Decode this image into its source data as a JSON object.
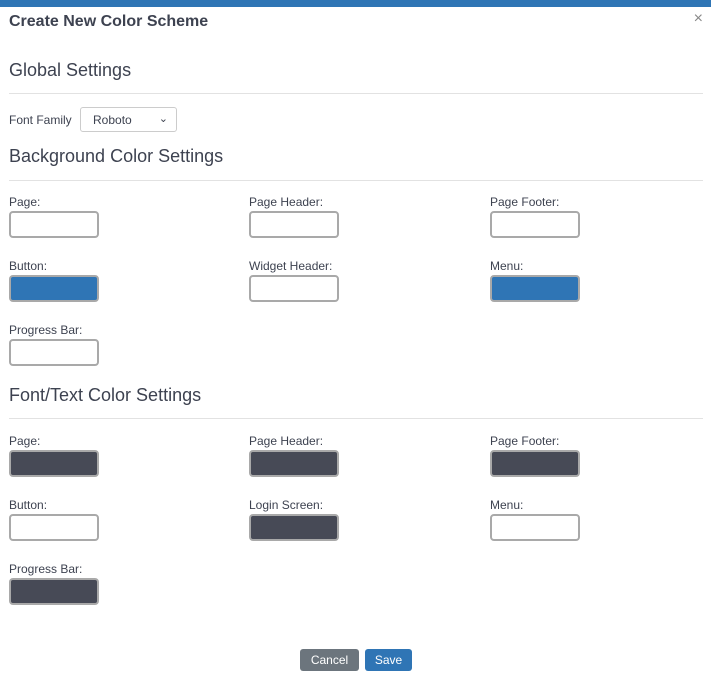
{
  "dialog": {
    "title": "Create New Color Scheme",
    "close": "×"
  },
  "global": {
    "heading": "Global Settings",
    "font_label": "Font Family",
    "font_value": "Roboto"
  },
  "background": {
    "heading": "Background Color Settings",
    "fields": [
      {
        "label": "Page:",
        "color": "#ffffff"
      },
      {
        "label": "Page Header:",
        "color": "#ffffff"
      },
      {
        "label": "Page Footer:",
        "color": "#ffffff"
      },
      {
        "label": "Button:",
        "color": "#2f75b5"
      },
      {
        "label": "Widget Header:",
        "color": "#ffffff"
      },
      {
        "label": "Menu:",
        "color": "#2f75b5"
      },
      {
        "label": "Progress Bar:",
        "color": "#ffffff"
      }
    ]
  },
  "font": {
    "heading": "Font/Text Color Settings",
    "fields": [
      {
        "label": "Page:",
        "color": "#474a56"
      },
      {
        "label": "Page Header:",
        "color": "#474a56"
      },
      {
        "label": "Page Footer:",
        "color": "#474a56"
      },
      {
        "label": "Button:",
        "color": "#ffffff"
      },
      {
        "label": "Login Screen:",
        "color": "#474a56"
      },
      {
        "label": "Menu:",
        "color": "#ffffff"
      },
      {
        "label": "Progress Bar:",
        "color": "#474a56"
      }
    ]
  },
  "buttons": {
    "cancel": "Cancel",
    "save": "Save",
    "cancel_color": "#6c757d",
    "save_color": "#2f75b5"
  }
}
